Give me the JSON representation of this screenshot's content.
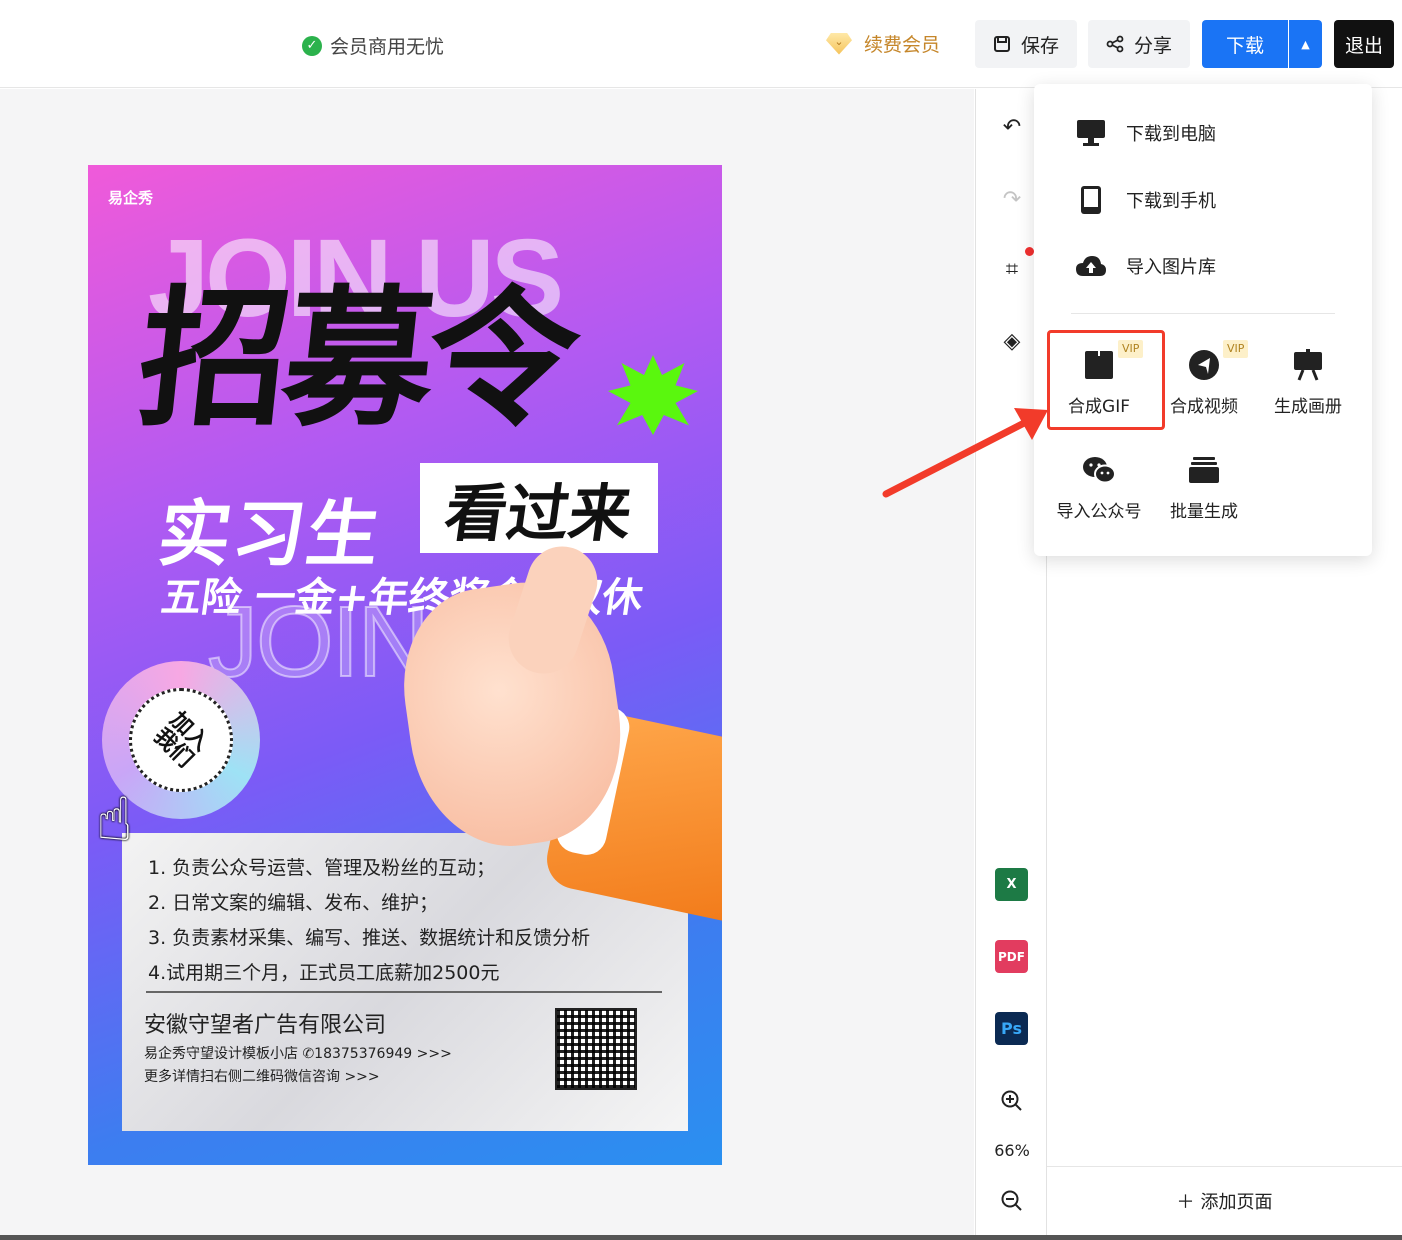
{
  "topbar": {
    "member_text": "会员商用无忧",
    "renew_label": "续费会员",
    "save_label": "保存",
    "share_label": "分享",
    "download_label": "下载",
    "exit_label": "退出"
  },
  "poster": {
    "logo": "易企秀",
    "bg_text": "JOIN US",
    "title": "招募令",
    "subtitle_left": "实习生",
    "subtitle_right": "看过来",
    "benefits": "五险 一金+年终奖金+双休",
    "badge": "加入我们",
    "duties": [
      "1. 负责公众号运营、管理及粉丝的互动；",
      "2. 日常文案的编辑、发布、维护；",
      "3. 负责素材采集、编写、推送、数据统计和反馈分析",
      "4.试用期三个月，正式员工底薪加2500元"
    ],
    "company": "安徽守望者广告有限公司",
    "contact_line": "易企秀守望设计模板小店  ✆18375376949 >>>",
    "qr_line": "更多详情扫右侧二维码微信咨询 >>>"
  },
  "tools": {
    "zoom": "66%",
    "excel": "X",
    "pdf": "PDF",
    "ps": "Ps"
  },
  "panel": {
    "add_page": "添加页面"
  },
  "menu": {
    "items": [
      {
        "label": "下载到电脑"
      },
      {
        "label": "下载到手机"
      },
      {
        "label": "导入图片库"
      }
    ],
    "grid": [
      {
        "label": "合成GIF",
        "vip": "VIP"
      },
      {
        "label": "合成视频",
        "vip": "VIP"
      },
      {
        "label": "生成画册"
      },
      {
        "label": "导入公众号"
      },
      {
        "label": "批量生成"
      }
    ]
  },
  "colors": {
    "primary": "#1a74f5",
    "highlight": "#f23b2a",
    "vip_bg": "#fdf0c9"
  }
}
